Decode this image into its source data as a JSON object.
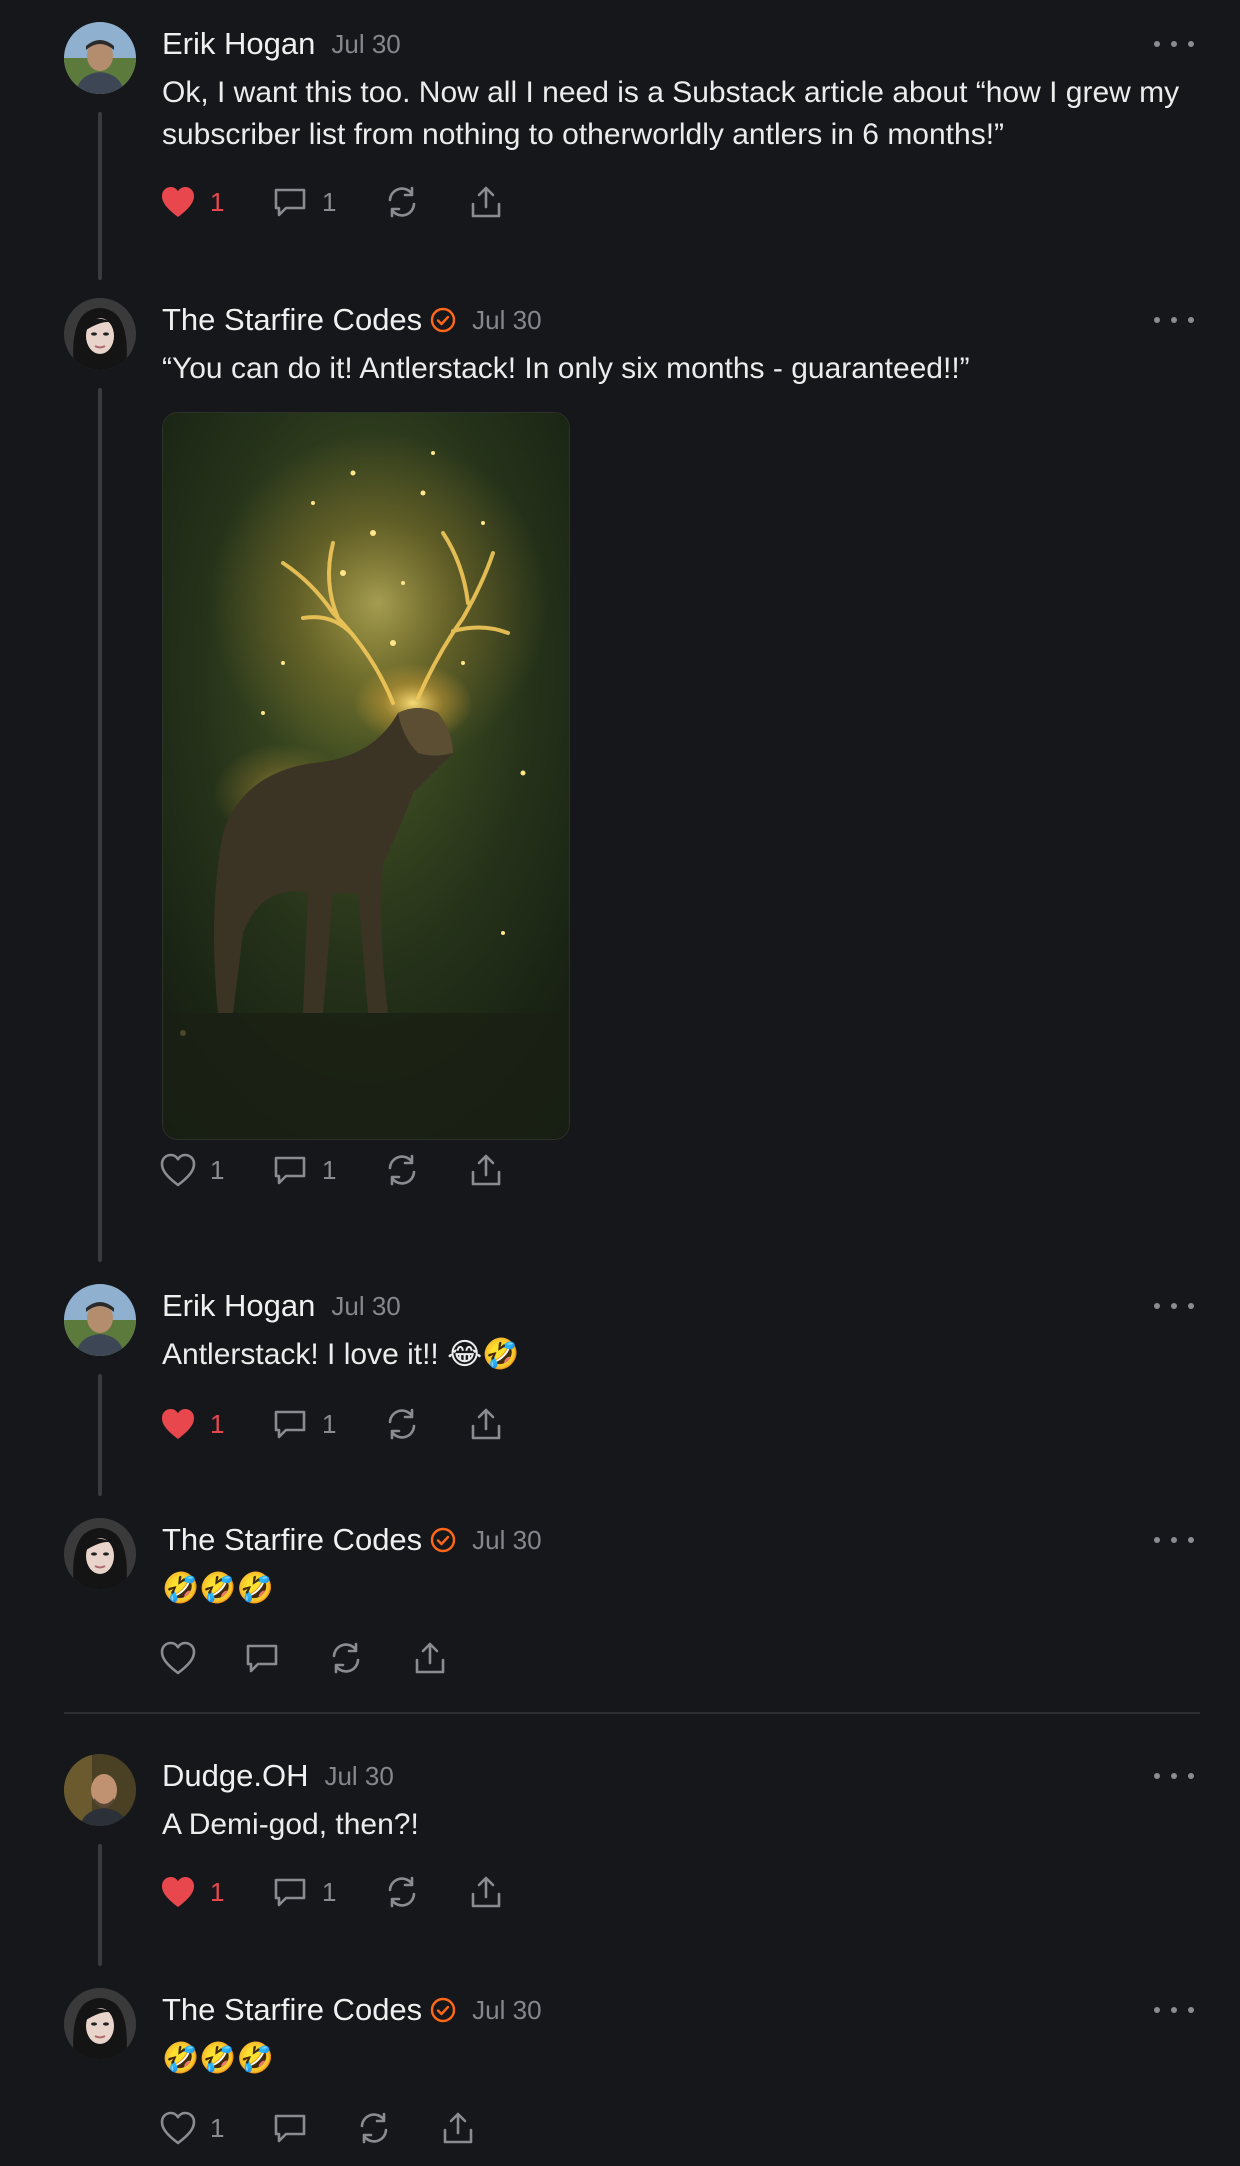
{
  "notes": [
    {
      "author": "Erik Hogan",
      "date": "Jul 30",
      "text": "Ok, I want this too. Now all I need is a Substack article about “how I grew my subscriber list from nothing to otherworldly antlers in 6 months!”",
      "likes": "1",
      "liked": true,
      "comments": "1"
    },
    {
      "author": "The Starfire Codes",
      "date": "Jul 30",
      "text": "“You can do it! Antlerstack! In only six months - guaranteed!!”",
      "likes": "1",
      "liked": false,
      "comments": "1"
    },
    {
      "author": "Erik Hogan",
      "date": "Jul 30",
      "text": "Antlerstack! I love it!! 😂🤣",
      "likes": "1",
      "liked": true,
      "comments": "1"
    },
    {
      "author": "The Starfire Codes",
      "date": "Jul 30",
      "text": "🤣🤣🤣",
      "likes": "",
      "liked": false,
      "comments": ""
    },
    {
      "author": "Dudge.OH",
      "date": "Jul 30",
      "text": "A Demi-god, then?!",
      "likes": "1",
      "liked": true,
      "comments": "1"
    },
    {
      "author": "The Starfire Codes",
      "date": "Jul 30",
      "text": "🤣🤣🤣",
      "likes": "1",
      "liked": false,
      "comments": ""
    }
  ],
  "icons": {
    "like": "heart-icon",
    "comment": "comment-icon",
    "restack": "restack-icon",
    "share": "share-icon",
    "more": "more-options-icon",
    "verified": "verified-check-icon"
  },
  "colors": {
    "background": "#16171a",
    "liked": "#e8484d",
    "verified": "#ff6719",
    "muted": "#8a8c91"
  }
}
